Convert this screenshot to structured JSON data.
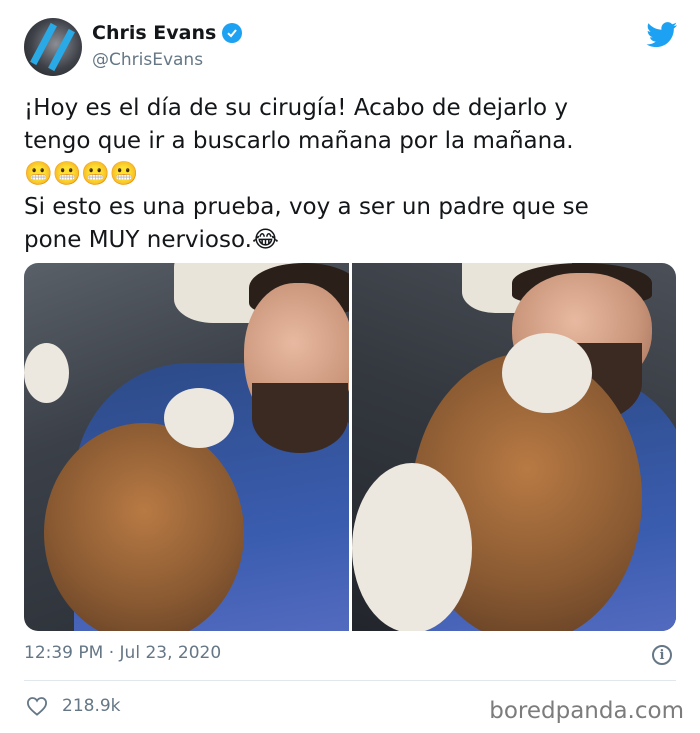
{
  "author": {
    "name": "Chris Evans",
    "handle": "@ChrisEvans"
  },
  "tweet": {
    "text": "¡Hoy es el día de su cirugía! Acabo de dejarlo y\ntengo que ir a buscarlo mañana por la mañana.\n😬😬😬😬\nSi esto es una prueba, voy a ser un padre que se\npone MUY nervioso.😂"
  },
  "meta": {
    "timestamp": "12:39 PM · Jul 23, 2020",
    "likes": "218.9k"
  },
  "watermark": "boredpanda.com",
  "colors": {
    "twitter_blue": "#1da1f2",
    "muted_text": "#657786"
  },
  "icons": [
    "verified-badge-icon",
    "twitter-bird-icon",
    "info-icon",
    "heart-icon"
  ]
}
